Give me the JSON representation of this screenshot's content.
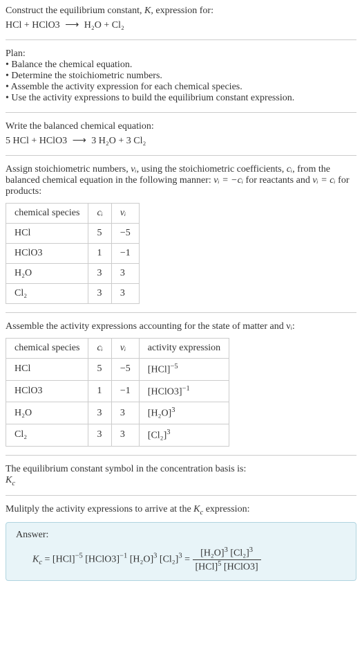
{
  "intro": {
    "line1": "Construct the equilibrium constant, K, expression for:",
    "equation_lhs": "HCl + HClO3",
    "equation_rhs": "H₂O + Cl₂"
  },
  "plan": {
    "heading": "Plan:",
    "b1": "• Balance the chemical equation.",
    "b2": "• Determine the stoichiometric numbers.",
    "b3": "• Assemble the activity expression for each chemical species.",
    "b4": "• Use the activity expressions to build the equilibrium constant expression."
  },
  "balanced": {
    "heading": "Write the balanced chemical equation:",
    "lhs": "5 HCl + HClO3",
    "rhs": "3 H₂O + 3 Cl₂"
  },
  "stoich": {
    "heading_part1": "Assign stoichiometric numbers, ",
    "heading_part2": ", using the stoichiometric coefficients, ",
    "heading_part3": ", from the balanced chemical equation in the following manner: ",
    "heading_part4": " for reactants and ",
    "heading_part5": " for products:",
    "nu_i": "νᵢ",
    "c_i": "cᵢ",
    "eq1": "νᵢ = −cᵢ",
    "eq2": "νᵢ = cᵢ",
    "table": {
      "h1": "chemical species",
      "h2": "cᵢ",
      "h3": "νᵢ",
      "rows": [
        {
          "species": "HCl",
          "c": "5",
          "nu": "−5"
        },
        {
          "species": "HClO3",
          "c": "1",
          "nu": "−1"
        },
        {
          "species": "H₂O",
          "c": "3",
          "nu": "3"
        },
        {
          "species": "Cl₂",
          "c": "3",
          "nu": "3"
        }
      ]
    }
  },
  "activity": {
    "heading": "Assemble the activity expressions accounting for the state of matter and νᵢ:",
    "table": {
      "h1": "chemical species",
      "h2": "cᵢ",
      "h3": "νᵢ",
      "h4": "activity expression",
      "rows": [
        {
          "species": "HCl",
          "c": "5",
          "nu": "−5",
          "act_base": "[HCl]",
          "act_exp": "−5"
        },
        {
          "species": "HClO3",
          "c": "1",
          "nu": "−1",
          "act_base": "[HClO3]",
          "act_exp": "−1"
        },
        {
          "species": "H₂O",
          "c": "3",
          "nu": "3",
          "act_base": "[H₂O]",
          "act_exp": "3"
        },
        {
          "species": "Cl₂",
          "c": "3",
          "nu": "3",
          "act_base": "[Cl₂]",
          "act_exp": "3"
        }
      ]
    }
  },
  "symbol": {
    "heading": "The equilibrium constant symbol in the concentration basis is:",
    "kc": "K",
    "kc_sub": "c"
  },
  "multiply": {
    "heading": "Mulitply the activity expressions to arrive at the Kc expression:"
  },
  "answer": {
    "label": "Answer:",
    "kc": "K",
    "kc_sub": "c",
    "eq": " = ",
    "t1_base": "[HCl]",
    "t1_exp": "−5",
    "t2_base": "[HClO3]",
    "t2_exp": "−1",
    "t3_base": "[H₂O]",
    "t3_exp": "3",
    "t4_base": "[Cl₂]",
    "t4_exp": "3",
    "num1_base": "[H₂O]",
    "num1_exp": "3",
    "num2_base": "[Cl₂]",
    "num2_exp": "3",
    "den1_base": "[HCl]",
    "den1_exp": "5",
    "den2_base": "[HClO3]"
  }
}
